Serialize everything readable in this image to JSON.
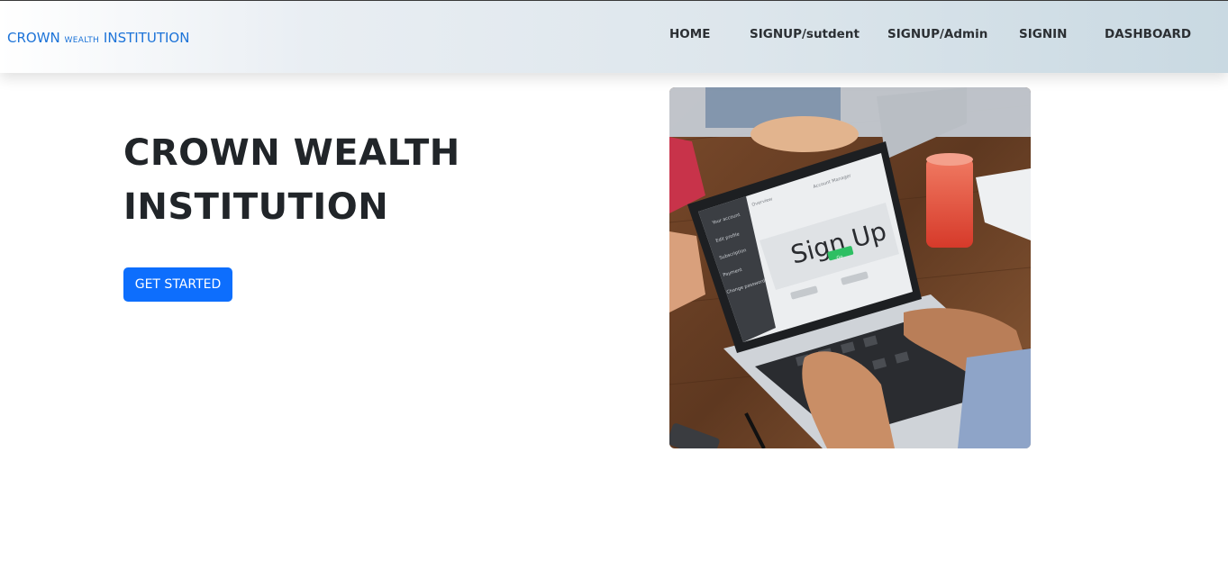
{
  "navbar": {
    "brand_main": "CROWN",
    "brand_small": "WEALTH",
    "brand_end": "INSTITUTION",
    "links": [
      "HOME",
      "SIGNUP/sutdent",
      "SIGNUP/Admin",
      "SIGNIN",
      "DASHBOARD"
    ]
  },
  "hero": {
    "title_line1": "CROWN WEALTH",
    "title_line2": "INSTITUTION",
    "cta_label": "GET STARTED",
    "image": {
      "screen_heading": "Sign Up",
      "screen_tab1": "Overview",
      "screen_tab2": "Account Manager",
      "screen_button": "Go",
      "sidebar_items": [
        "Your account",
        "Edit profile",
        "Subscription",
        "Payment",
        "Change password"
      ]
    }
  },
  "colors": {
    "brand": "#1c73d8",
    "primary_button": "#0d6efd",
    "heading": "#212529",
    "nav_text": "#2b2f33"
  }
}
